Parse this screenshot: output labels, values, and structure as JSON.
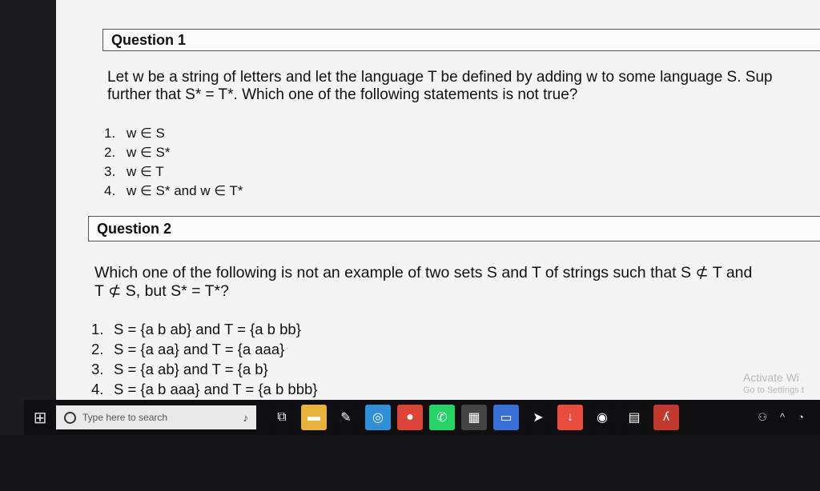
{
  "question1": {
    "header": "Question 1",
    "text_line1": "Let w be a string of letters and let the language T be defined by adding w to some language S. Sup",
    "text_line2": "further that S* = T*. Which one of the following statements is not true?",
    "options": [
      {
        "num": "1.",
        "text": "w ∈ S"
      },
      {
        "num": "2.",
        "text": "w ∈ S*"
      },
      {
        "num": "3.",
        "text": "w ∈ T"
      },
      {
        "num": "4.",
        "text": "w ∈ S* and w ∈ T*"
      }
    ]
  },
  "question2": {
    "header": "Question 2",
    "text_line1": "Which one of the following is not an example of two sets S and T of strings such that S ⊄ T and",
    "text_line2": "T ⊄ S, but S* = T*?",
    "options": [
      {
        "num": "1.",
        "text": "S = {a b ab} and T = {a b bb}"
      },
      {
        "num": "2.",
        "text": "S = {a aa} and T = {a aaa}"
      },
      {
        "num": "3.",
        "text": "S = {a ab} and T = {a b}"
      },
      {
        "num": "4.",
        "text": "S = {a b aaa} and T = {a b bbb}"
      }
    ]
  },
  "watermark": {
    "line1": "Activate Wi",
    "line2": "Go to Settings t"
  },
  "taskbar": {
    "search_placeholder": "Type here to search",
    "icons": [
      {
        "name": "task-view-icon",
        "glyph": "⧉",
        "color": "#0f0f12"
      },
      {
        "name": "file-explorer-icon",
        "glyph": "▬",
        "color": "#e8b33a"
      },
      {
        "name": "store-icon",
        "glyph": "✎",
        "color": "#0f0f12"
      },
      {
        "name": "app-blue-icon",
        "glyph": "◎",
        "color": "#2f8fd8"
      },
      {
        "name": "chrome-icon",
        "glyph": "●",
        "color": "#db4437"
      },
      {
        "name": "whatsapp-icon",
        "glyph": "✆",
        "color": "#25d366"
      },
      {
        "name": "calculator-icon",
        "glyph": "▦",
        "color": "#444"
      },
      {
        "name": "dev-app-icon",
        "glyph": "▭",
        "color": "#3a6fd8"
      },
      {
        "name": "send-icon",
        "glyph": "➤",
        "color": "#0f0f12"
      },
      {
        "name": "download-icon",
        "glyph": "↓",
        "color": "#e74c3c"
      },
      {
        "name": "opera-icon",
        "glyph": "◉",
        "color": "#0f0f12"
      },
      {
        "name": "media-icon",
        "glyph": "▤",
        "color": "#0f0f12"
      },
      {
        "name": "pdf-icon",
        "glyph": "ʎ",
        "color": "#c0392b"
      }
    ],
    "tray": [
      "people-icon",
      "chevron-up-icon",
      "wifi-icon"
    ]
  }
}
